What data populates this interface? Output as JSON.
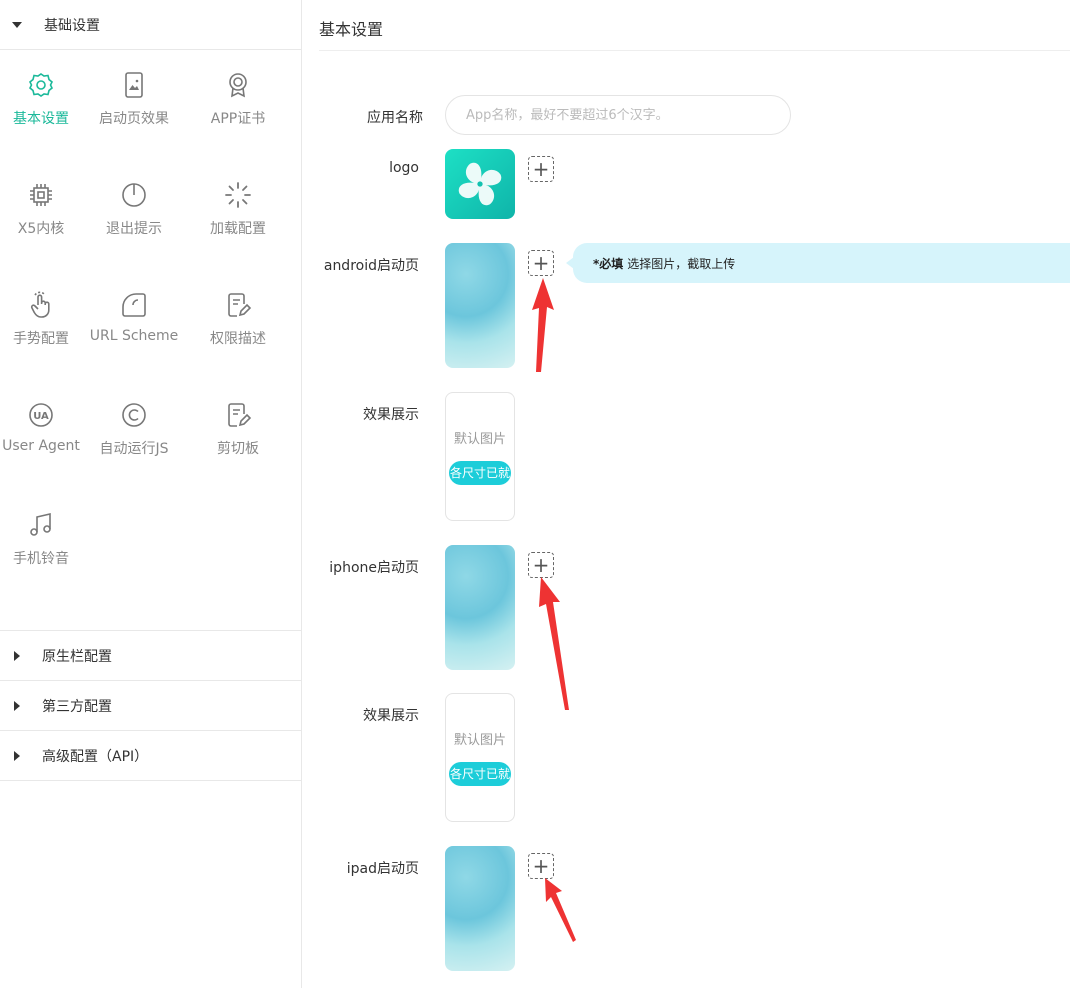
{
  "sidebar": {
    "sections": [
      {
        "label": "基础设置",
        "expanded": true
      },
      {
        "label": "原生栏配置",
        "expanded": false
      },
      {
        "label": "第三方配置",
        "expanded": false
      },
      {
        "label": "高级配置（API）",
        "expanded": false
      }
    ],
    "items": [
      {
        "label": "基本设置",
        "icon": "gear-icon",
        "active": true
      },
      {
        "label": "启动页效果",
        "icon": "phone-image-icon"
      },
      {
        "label": "APP证书",
        "icon": "certificate-icon"
      },
      {
        "label": "X5内核",
        "icon": "chip-icon"
      },
      {
        "label": "退出提示",
        "icon": "power-icon"
      },
      {
        "label": "加载配置",
        "icon": "loading-spinner-icon"
      },
      {
        "label": "手势配置",
        "icon": "hand-gesture-icon"
      },
      {
        "label": "URL Scheme",
        "icon": "link-scheme-icon"
      },
      {
        "label": "权限描述",
        "icon": "edit-document-icon"
      },
      {
        "label": "User Agent",
        "icon": "ua-icon"
      },
      {
        "label": "自动运行JS",
        "icon": "copyright-icon"
      },
      {
        "label": "剪切板",
        "icon": "clipboard-edit-icon"
      },
      {
        "label": "手机铃音",
        "icon": "music-note-icon"
      }
    ]
  },
  "main": {
    "title": "基本设置",
    "fields": {
      "app_name_label": "应用名称",
      "app_name_placeholder": "App名称，最好不要超过6个汉字。",
      "logo_label": "logo",
      "android_label": "android启动页",
      "android_preview_label": "效果展示",
      "iphone_label": "iphone启动页",
      "iphone_preview_label": "效果展示",
      "ipad_label": "ipad启动页"
    },
    "preview": {
      "placeholder": "默认图片",
      "badge": "各尺寸已就"
    },
    "tip": {
      "required": "*必填",
      "text": "选择图片，截取上传"
    },
    "add_symbol": "+"
  },
  "colors": {
    "accent": "#1bb99a",
    "badge": "#1dcdd9",
    "tip_bg": "#d6f4fb",
    "arrow": "#ee3333"
  }
}
